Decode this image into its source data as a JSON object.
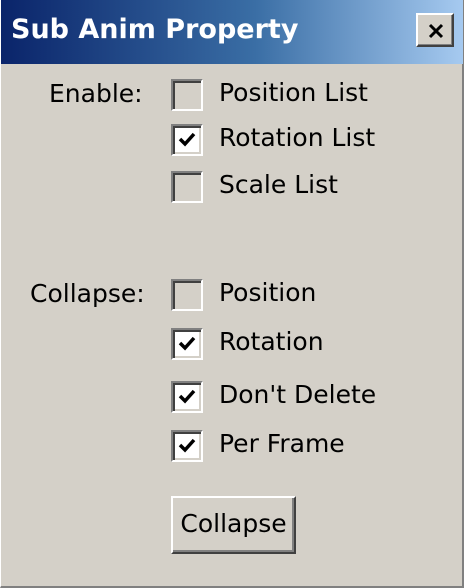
{
  "window": {
    "title": "Sub Anim Property",
    "close_label": "×"
  },
  "enable": {
    "label": "Enable:",
    "items": [
      {
        "label": "Position List",
        "checked": false
      },
      {
        "label": "Rotation List",
        "checked": true
      },
      {
        "label": "Scale List",
        "checked": false
      }
    ]
  },
  "collapse": {
    "label": "Collapse:",
    "items": [
      {
        "label": "Position",
        "checked": false
      },
      {
        "label": "Rotation",
        "checked": true
      },
      {
        "label": "Don't Delete",
        "checked": true
      },
      {
        "label": "Per Frame",
        "checked": true
      }
    ]
  },
  "buttons": {
    "collapse_label": "Collapse"
  },
  "colors": {
    "title_gradient_start": "#0a246a",
    "title_gradient_end": "#a6caf0",
    "face": "#d4d0c8"
  }
}
